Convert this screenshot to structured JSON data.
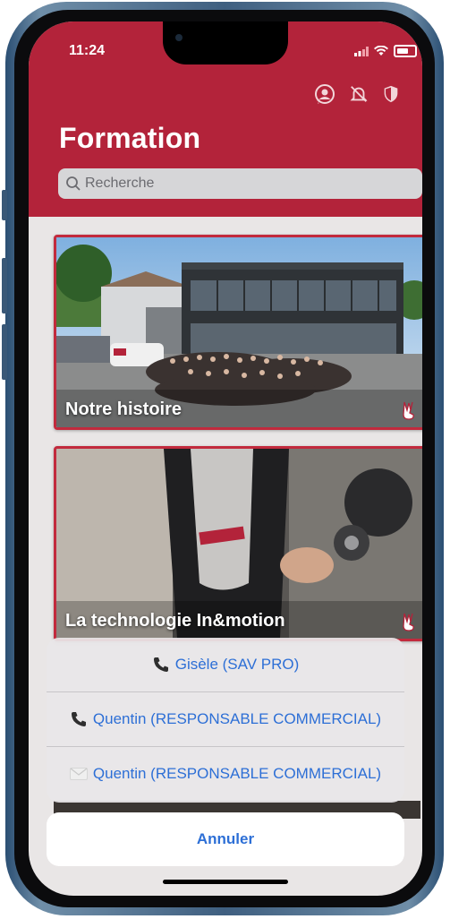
{
  "status_bar": {
    "time": "11:24"
  },
  "header": {
    "title": "Formation",
    "icons": [
      "support-icon",
      "no-notification-icon",
      "shield-icon"
    ],
    "search": {
      "placeholder": "Recherche"
    }
  },
  "cards": [
    {
      "label": "Notre histoire",
      "badge_icon": "victory-hand-icon"
    },
    {
      "label": "La technologie In&motion",
      "badge_icon": "victory-hand-icon"
    }
  ],
  "action_sheet": {
    "items": [
      {
        "label": "Gisèle (SAV PRO)",
        "icon": "phone-icon"
      },
      {
        "label": "Quentin (RESPONSABLE COMMERCIAL)",
        "icon": "phone-icon"
      },
      {
        "label": "Quentin (RESPONSABLE COMMERCIAL)",
        "icon": "mail-icon"
      }
    ],
    "cancel_label": "Annuler"
  },
  "colors": {
    "brand_red": "#b3233a",
    "action_blue": "#2d6fd6"
  }
}
